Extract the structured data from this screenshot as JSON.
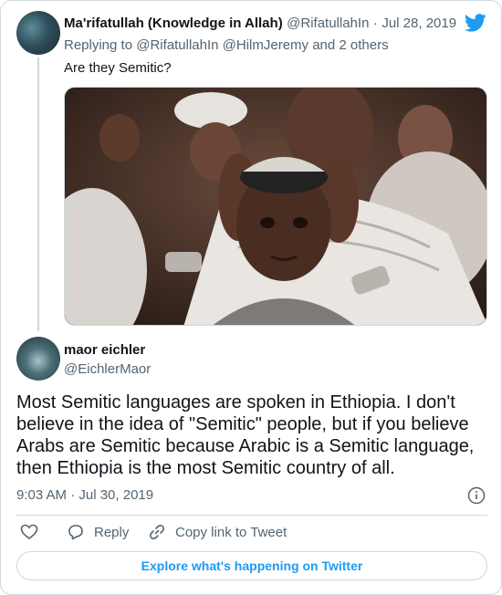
{
  "quoted_tweet": {
    "author_name": "Ma'rifatullah (Knowledge in Allah)",
    "author_handle": "@RifatullahIn",
    "separator": "·",
    "date": "Jul 28, 2019",
    "replying_prefix": "Replying to",
    "replying_to": "@RifatullahIn @HilmJeremy and 2 others",
    "text": "Are they Semitic?",
    "avatar_icon": "avatar-landscape",
    "brand_icon": "twitter-bird-icon",
    "brand_color": "#1d9bf0"
  },
  "reply_tweet": {
    "author_name": "maor eichler",
    "author_handle": "@EichlerMaor",
    "avatar_icon": "avatar-photo",
    "text": "Most Semitic languages are spoken in Ethiopia. I don't believe in the idea of \"Semitic\" people, but if you believe Arabs are Semitic because Arabic is a Semitic language, then Ethiopia is the most Semitic country of all.",
    "timestamp": "9:03 AM · Jul 30, 2019",
    "info_icon": "info-icon"
  },
  "actions": {
    "like_icon": "heart-icon",
    "reply_label": "Reply",
    "reply_icon": "reply-icon",
    "copy_label": "Copy link to Tweet",
    "copy_icon": "link-icon"
  },
  "footer": {
    "explore_label": "Explore what's happening on Twitter"
  },
  "colors": {
    "text_primary": "#0f1419",
    "text_secondary": "#536471",
    "border": "#cfd9de",
    "accent": "#1d9bf0"
  }
}
